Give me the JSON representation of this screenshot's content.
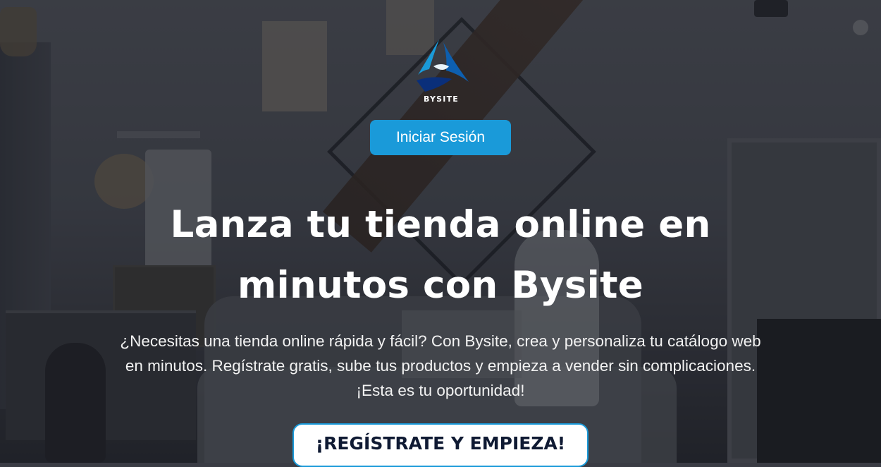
{
  "brand": {
    "name": "BYSITE",
    "logo_icon": "bysite-triangle-logo-icon",
    "logo_colors": [
      "#1a9ad9",
      "#0d5fb0",
      "#0a2f7a"
    ]
  },
  "header": {
    "login_label": "Iniciar Sesión"
  },
  "hero": {
    "headline": "Lanza tu tienda online en minutos con Bysite",
    "description": "¿Necesitas una tienda online rápida y fácil? Con Bysite, crea y personaliza tu catálogo web en minutos. Regístrate gratis, sube tus productos y empieza a vender sin complicaciones. ¡Esta es tu oportunidad!",
    "cta_label": "¡REGÍSTRATE Y EMPIEZA!"
  },
  "colors": {
    "accent": "#1a9ad9",
    "text_on_dark": "#ffffff",
    "cta_text": "#0f1a33",
    "cta_border": "#1a9ad9"
  }
}
